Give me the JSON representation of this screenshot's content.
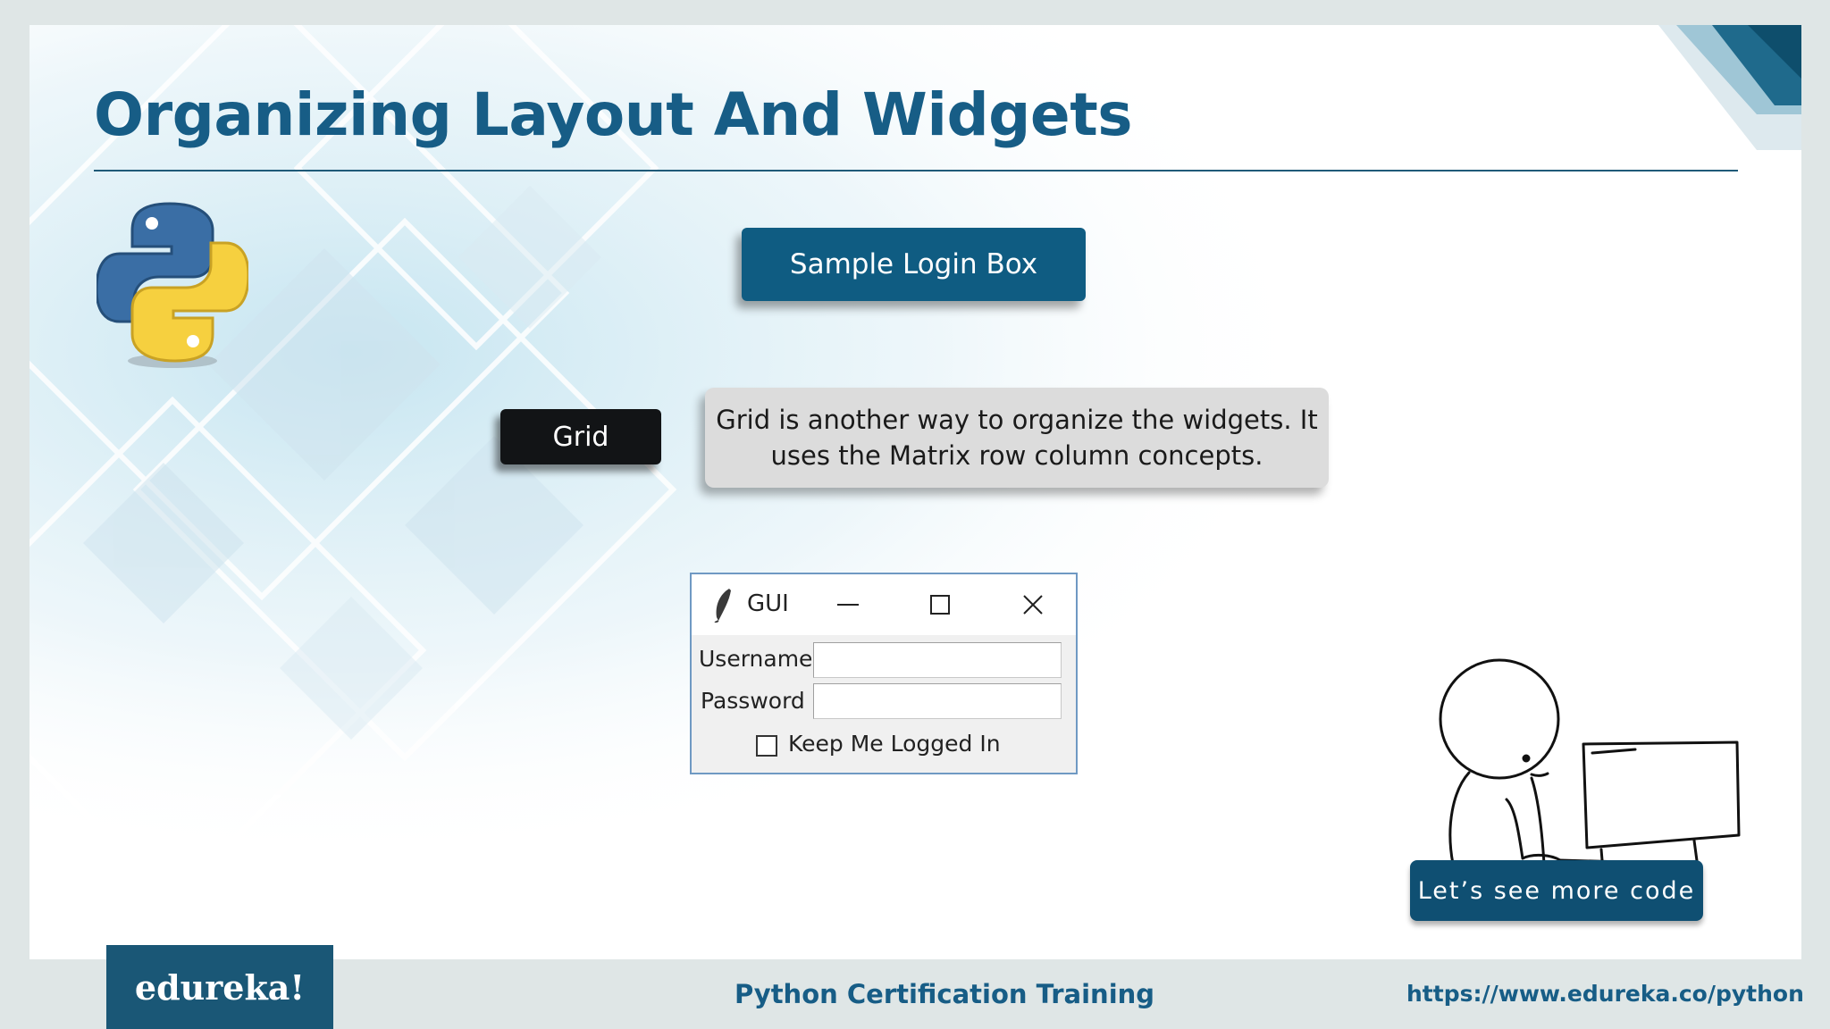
{
  "slide": {
    "title": "Organizing Layout And Widgets",
    "login_box_label": "Sample Login Box",
    "grid_label": "Grid",
    "description": "Grid is another way to organize the widgets. It uses the Matrix row column concepts.",
    "cta_label": "Let’s see more code"
  },
  "tk_window": {
    "title": "GUI",
    "username_label": "Username",
    "username_value": "",
    "password_label": "Password",
    "password_value": "",
    "checkbox_label": "Keep Me Logged In",
    "checkbox_checked": false
  },
  "footer": {
    "brand": "edureka!",
    "course": "Python Certification Training",
    "url": "https://www.edureka.co/python"
  },
  "icons": {
    "python": "python-logo-icon",
    "feather": "tk-feather-icon",
    "minimize": "minimize-icon",
    "maximize": "maximize-icon",
    "close": "close-icon"
  },
  "colors": {
    "title_blue": "#175d86",
    "button_blue": "#0f5c82",
    "button_black": "#121416",
    "desc_gray": "#dcdcdc",
    "footer_gray": "#dfe6e6",
    "brand_blue": "#1a5776",
    "cta_blue": "#0f4f72"
  }
}
